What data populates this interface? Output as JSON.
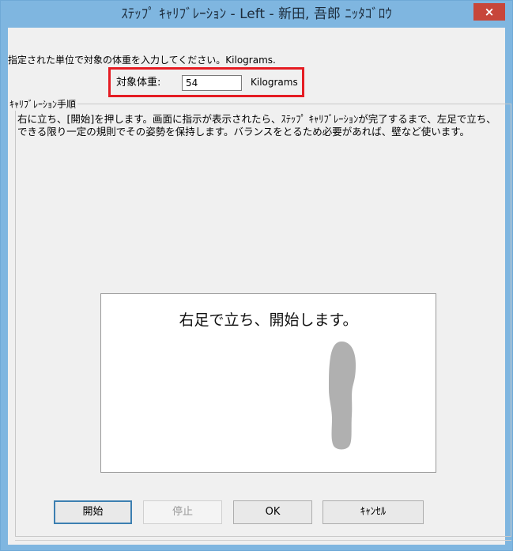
{
  "window": {
    "title": "ｽﾃｯﾌﾟ ｷｬﾘﾌﾞﾚｰｼｮﾝ - Left - 新田, 吾郎 ﾆｯﾀｺﾞﾛｳ",
    "close_icon": "close-icon",
    "close_label": "×"
  },
  "form": {
    "instruction": "指定された単位で対象の体重を入力してください。Kilograms.",
    "weight_label": "対象体重:",
    "weight_value": "54",
    "weight_unit": "Kilograms",
    "highlight_color": "#e51c23"
  },
  "calibration": {
    "group_title": "ｷｬﾘﾌﾞﾚｰｼｮﾝ手順",
    "procedure_text": "右に立ち、[開始]を押します。画面に指示が表示されたら、ｽﾃｯﾌﾟ ｷｬﾘﾌﾞﾚｰｼｮﾝが完了するまで、左足で立ち、できる限り一定の規則でその姿勢を保持します。バランスをとるため必要があれば、壁など使います。",
    "prompt_text": "右足で立ち、開始します。",
    "footprint_icon": "footprint-icon"
  },
  "buttons": {
    "start": "開始",
    "stop": "停止",
    "ok": "OK",
    "cancel": "ｷｬﾝｾﾙ"
  }
}
